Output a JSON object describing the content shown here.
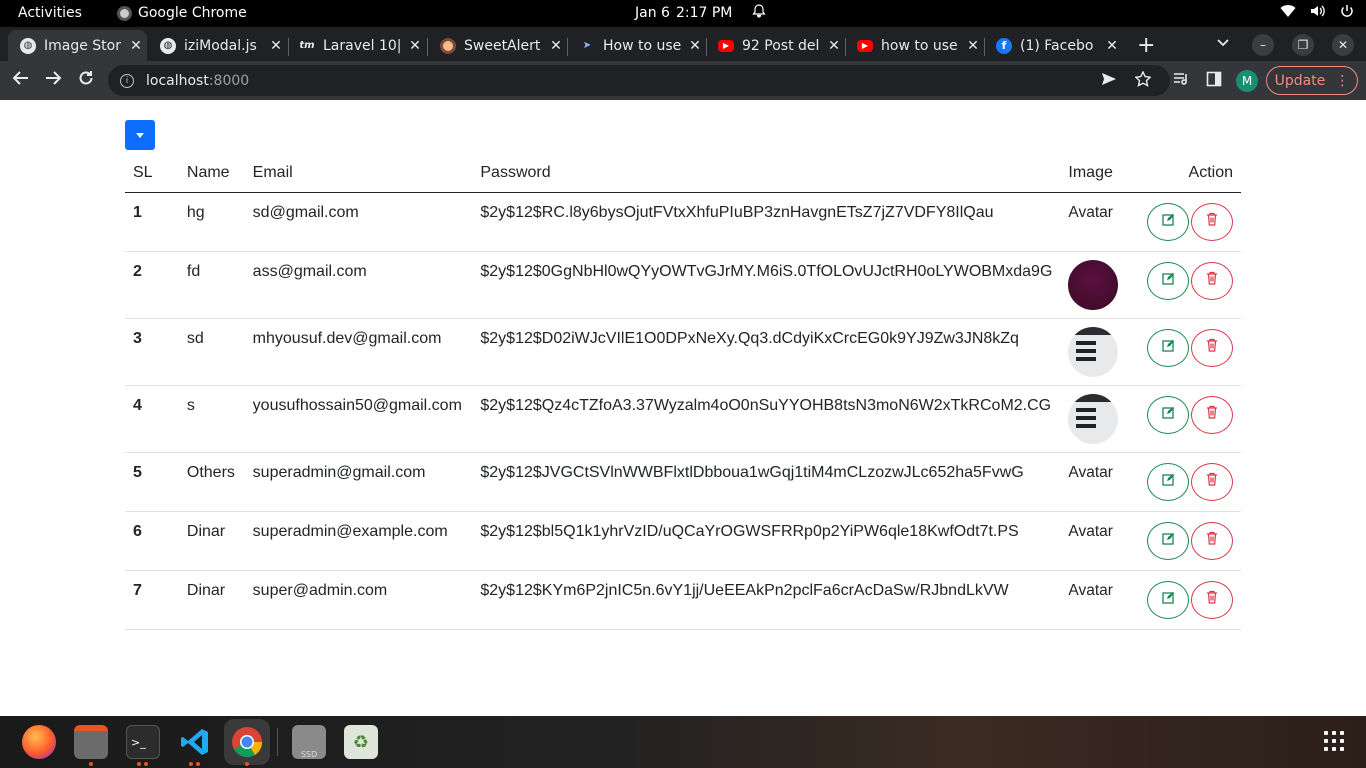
{
  "topbar": {
    "activities": "Activities",
    "app_name": "Google Chrome",
    "date": "Jan 6",
    "time": "2:17 PM"
  },
  "tabs": [
    {
      "title": "Image Stor",
      "active": true
    },
    {
      "title": "iziModal.js"
    },
    {
      "title": "Laravel 10|"
    },
    {
      "title": "SweetAlert"
    },
    {
      "title": "How to use"
    },
    {
      "title": "92 Post del"
    },
    {
      "title": "how to use"
    },
    {
      "title": "(1) Facebo"
    }
  ],
  "toolbar": {
    "url_host": "localhost",
    "url_port": ":8000",
    "profile_initial": "M",
    "update_label": "Update"
  },
  "table": {
    "headers": {
      "sl": "SL",
      "name": "Name",
      "email": "Email",
      "password": "Password",
      "image": "Image",
      "action": "Action"
    },
    "rows": [
      {
        "sl": "1",
        "name": "hg",
        "email": "sd@gmail.com",
        "password": "$2y$12$RC.l8y6bysOjutFVtxXhfuPIuBP3znHavgnETsZ7jZ7VDFY8IlQau",
        "image": "Avatar"
      },
      {
        "sl": "2",
        "name": "fd",
        "email": "ass@gmail.com",
        "password": "$2y$12$0GgNbHl0wQYyOWTvGJrMY.M6iS.0TfOLOvUJctRH0oLYWOBMxda9G",
        "image": ""
      },
      {
        "sl": "3",
        "name": "sd",
        "email": "mhyousuf.dev@gmail.com",
        "password": "$2y$12$D02iWJcVIlE1O0DPxNeXy.Qq3.dCdyiKxCrcEG0k9YJ9Zw3JN8kZq",
        "image": ""
      },
      {
        "sl": "4",
        "name": "s",
        "email": "yousufhossain50@gmail.com",
        "password": "$2y$12$Qz4cTZfoA3.37Wyzalm4oO0nSuYYOHB8tsN3moN6W2xTkRCoM2.CG",
        "image": ""
      },
      {
        "sl": "5",
        "name": "Others",
        "email": "superadmin@gmail.com",
        "password": "$2y$12$JVGCtSVlnWWBFlxtlDbboua1wGqj1tiM4mCLzozwJLc652ha5FvwG",
        "image": "Avatar"
      },
      {
        "sl": "6",
        "name": "Dinar",
        "email": "superadmin@example.com",
        "password": "$2y$12$bl5Q1k1yhrVzID/uQCaYrOGWSFRRp0p2YiPW6qle18KwfOdt7t.PS",
        "image": "Avatar"
      },
      {
        "sl": "7",
        "name": "Dinar",
        "email": "super@admin.com",
        "password": "$2y$12$KYm6P2jnIC5n.6vY1jj/UeEEAkPn2pclFa6crAcDaSw/RJbndLkVW",
        "image": "Avatar"
      }
    ]
  },
  "colors": {
    "primary": "#0d6efd",
    "success": "#198754",
    "danger": "#dc3545"
  }
}
